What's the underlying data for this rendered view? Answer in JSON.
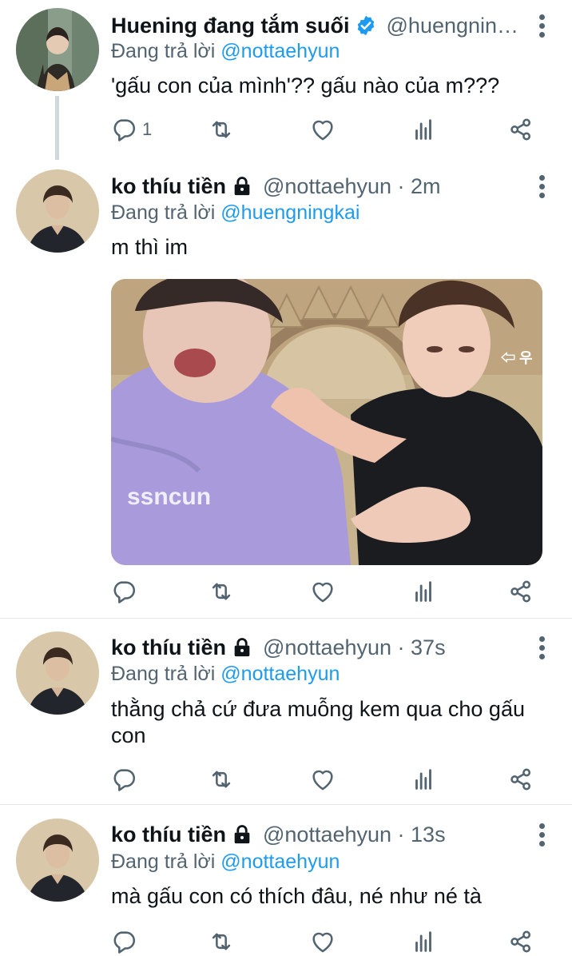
{
  "colors": {
    "accent": "#1d9bf0",
    "text": "#0f1419",
    "secondary": "#536471",
    "divider": "#e4e8eb",
    "thread_line": "#cfd9de"
  },
  "tweets": [
    {
      "name": "Huening đang tắm suối",
      "badge": "verified-icon",
      "handle": "@huengning...",
      "time": "",
      "replying_prefix": "Đang trả lời",
      "replying_to": "@nottaehyun",
      "text": "'gấu con của mình'?? gấu nào của m???",
      "reply_count": "1"
    },
    {
      "name": "ko thíu tiền",
      "badge": "lock-icon",
      "handle": "@nottaehyun",
      "time": "· 2m",
      "replying_prefix": "Đang trả lời",
      "replying_to": "@huengningkai",
      "text": "m thì im",
      "reply_count": "",
      "media": {
        "type": "photo",
        "shirt_text": "ssncun",
        "overlay_text": "⇦ 우"
      }
    },
    {
      "name": "ko thíu tiền",
      "badge": "lock-icon",
      "handle": "@nottaehyun",
      "time": "· 37s",
      "replying_prefix": "Đang trả lời",
      "replying_to": "@nottaehyun",
      "text": "thằng chả cứ đưa muỗng kem qua cho gấu con",
      "reply_count": ""
    },
    {
      "name": "ko thíu tiền",
      "badge": "lock-icon",
      "handle": "@nottaehyun",
      "time": "· 13s",
      "replying_prefix": "Đang trả lời",
      "replying_to": "@nottaehyun",
      "text": "mà gấu con có thích đâu, né như né tà",
      "reply_count": ""
    }
  ]
}
